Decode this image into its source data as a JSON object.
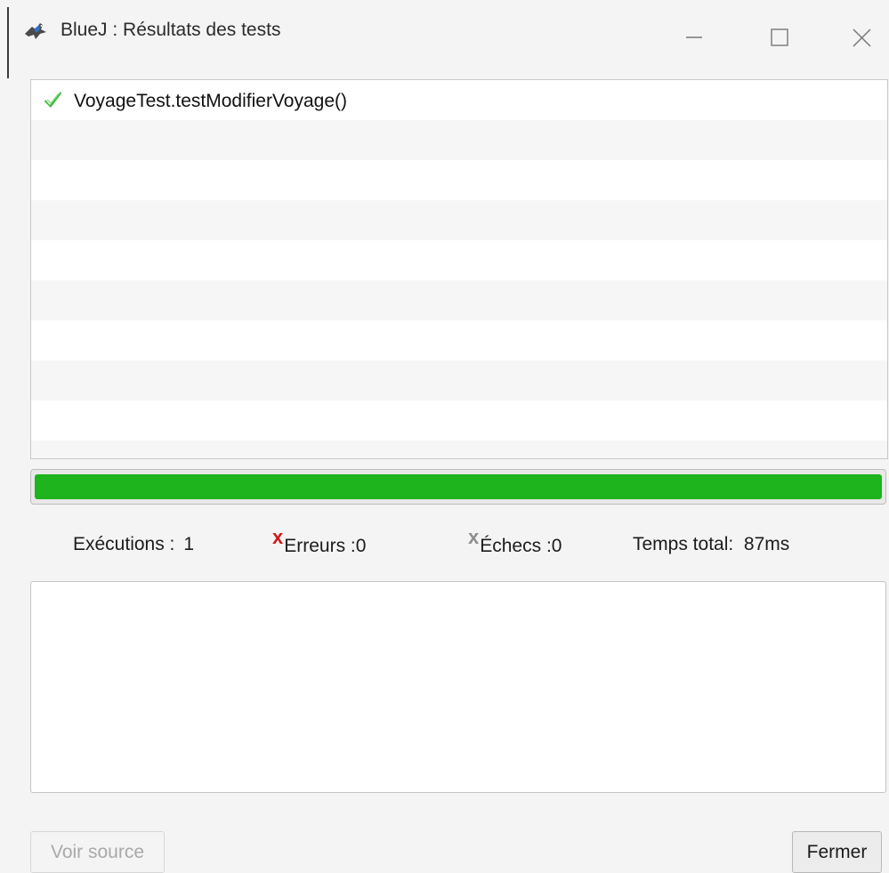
{
  "window": {
    "title": "BlueJ : Résultats des tests",
    "icon": "bluej-bird-icon"
  },
  "title_controls": {
    "minimize_icon": "minimize-icon",
    "maximize_icon": "maximize-icon",
    "close_icon": "close-icon"
  },
  "test_list": {
    "items": [
      {
        "label": "VoyageTest.testModifierVoyage()",
        "status": "passed",
        "icon": "check-icon"
      }
    ]
  },
  "progress": {
    "fraction": 1.0,
    "color": "#1db41d"
  },
  "stats": {
    "runs_label": "Exécutions :",
    "runs_value": "1",
    "errors_label": "Erreurs :",
    "errors_value": "0",
    "errors_icon": "error-x-icon",
    "errors_color": "#d11a1a",
    "failures_label": "Échecs :",
    "failures_value": "0",
    "failures_icon": "failure-x-icon",
    "failures_color": "#8f8f8f",
    "time_label": "Temps total:",
    "time_value": "87ms"
  },
  "buttons": {
    "source_label": "Voir source",
    "source_enabled": false,
    "close_label": "Fermer"
  }
}
